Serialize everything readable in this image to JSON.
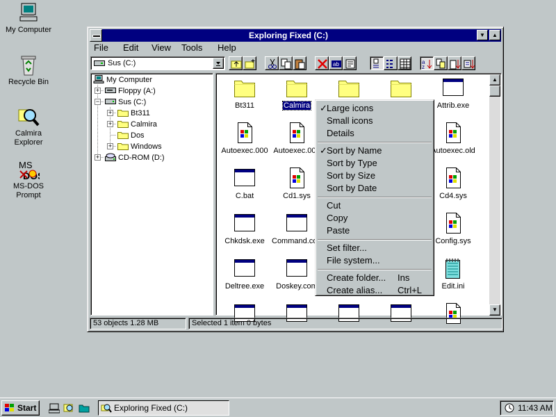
{
  "desktop": {
    "icons": [
      {
        "label": "My Computer"
      },
      {
        "label": "Recycle Bin"
      },
      {
        "label": "Calmira\nExplorer"
      },
      {
        "label": "MS-DOS\nPrompt"
      }
    ]
  },
  "window": {
    "title": "Exploring Fixed (C:)",
    "menu": [
      "File",
      "Edit",
      "View",
      "Tools",
      "Help"
    ],
    "drive_selector": "Sus (C:)",
    "tree": [
      {
        "label": "My Computer"
      },
      {
        "label": "Floppy (A:)"
      },
      {
        "label": "Sus (C:)"
      },
      {
        "label": "Bt311"
      },
      {
        "label": "Calmira"
      },
      {
        "label": "Dos"
      },
      {
        "label": "Windows"
      },
      {
        "label": "CD-ROM (D:)"
      }
    ],
    "files": [
      {
        "name": "Bt311",
        "icon": "folder"
      },
      {
        "name": "Calmira",
        "icon": "folder"
      },
      {
        "name": "",
        "icon": "folder"
      },
      {
        "name": "",
        "icon": "folder"
      },
      {
        "name": "Attrib.exe",
        "icon": "window"
      },
      {
        "name": "Autoexec.000",
        "icon": "sysfile"
      },
      {
        "name": "Autoexec.001",
        "icon": "sysfile"
      },
      {
        "name": "Autoexec.old",
        "icon": "sysfile"
      },
      {
        "name": "C.bat",
        "icon": "window"
      },
      {
        "name": "Cd1.sys",
        "icon": "sysfile"
      },
      {
        "name": "Cd4.sys",
        "icon": "sysfile"
      },
      {
        "name": "Chkdsk.exe",
        "icon": "window"
      },
      {
        "name": "Command.com",
        "icon": "window"
      },
      {
        "name": "Config.sys",
        "icon": "sysfile"
      },
      {
        "name": "Deltree.exe",
        "icon": "window"
      },
      {
        "name": "Doskey.com",
        "icon": "window"
      },
      {
        "name": "Edit.ini",
        "icon": "notepad"
      }
    ],
    "status": {
      "objects": "53 objects  1.28 MB",
      "selected": "Selected 1 item  0 bytes"
    }
  },
  "context_menu": {
    "items": [
      {
        "label": "Large icons",
        "checked": true
      },
      {
        "label": "Small icons"
      },
      {
        "label": "Details"
      },
      {
        "label": "Sort by Name",
        "checked": true
      },
      {
        "label": "Sort by Type"
      },
      {
        "label": "Sort by Size"
      },
      {
        "label": "Sort by Date"
      },
      {
        "label": "Cut"
      },
      {
        "label": "Copy"
      },
      {
        "label": "Paste"
      },
      {
        "label": "Set filter..."
      },
      {
        "label": "File system..."
      },
      {
        "label": "Create folder...",
        "shortcut": "Ins"
      },
      {
        "label": "Create alias...",
        "shortcut": "Ctrl+L"
      }
    ],
    "check_glyph": "✓"
  },
  "taskbar": {
    "start": "Start",
    "task": "Exploring Fixed (C:)",
    "clock": "11:43 AM"
  },
  "colors": {
    "titlebar": "#000080",
    "desktop": "#c0c7c8",
    "selection": "#000080"
  }
}
